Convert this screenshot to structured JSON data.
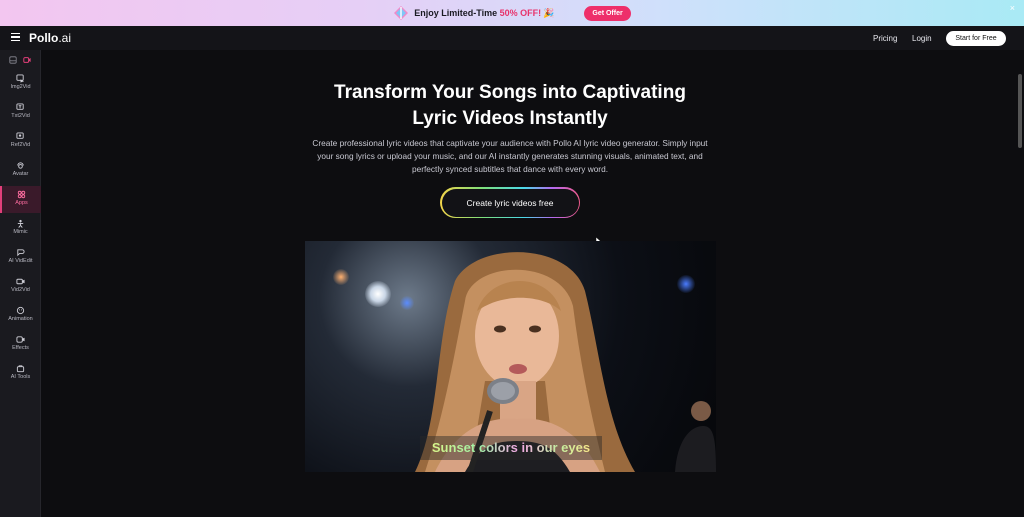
{
  "promo": {
    "text": "Enjoy Limited-Time ",
    "discount": "50% OFF!",
    "button": "Get Offer",
    "close": "×"
  },
  "nav": {
    "logo_main": "Pollo",
    "logo_suffix": ".ai",
    "pricing": "Pricing",
    "login": "Login",
    "start": "Start for Free"
  },
  "sidebar": {
    "items": [
      {
        "label": "Img2Vid",
        "icon": "image-video-icon"
      },
      {
        "label": "Txt2Vid",
        "icon": "text-video-icon"
      },
      {
        "label": "Ref2Vid",
        "icon": "reference-video-icon"
      },
      {
        "label": "Avatar",
        "icon": "avatar-icon"
      },
      {
        "label": "Apps",
        "icon": "apps-icon"
      },
      {
        "label": "Mimic",
        "icon": "mimic-icon"
      },
      {
        "label": "AI VidEdit",
        "icon": "video-edit-icon"
      },
      {
        "label": "Vid2Vid",
        "icon": "video-video-icon"
      },
      {
        "label": "Animation",
        "icon": "animation-icon"
      },
      {
        "label": "Effects",
        "icon": "effects-icon"
      },
      {
        "label": "AI Tools",
        "icon": "tools-icon"
      }
    ],
    "active": "Apps"
  },
  "hero": {
    "title_line1": "Transform Your Songs into Captivating",
    "title_line2": "Lyric Videos Instantly",
    "description": "Create professional lyric videos that captivate your audience with Pollo AI lyric video generator. Simply input your song lyrics or upload your music, and our AI instantly generates stunning visuals, animated text, and perfectly synced subtitles that dance with every word.",
    "cta": "Create lyric videos free"
  },
  "video": {
    "subtitle": "Sunset colors in our eyes"
  },
  "colors": {
    "accent": "#ee2f6a",
    "background": "#0d0d10",
    "sidebar": "#1a1a1f"
  }
}
